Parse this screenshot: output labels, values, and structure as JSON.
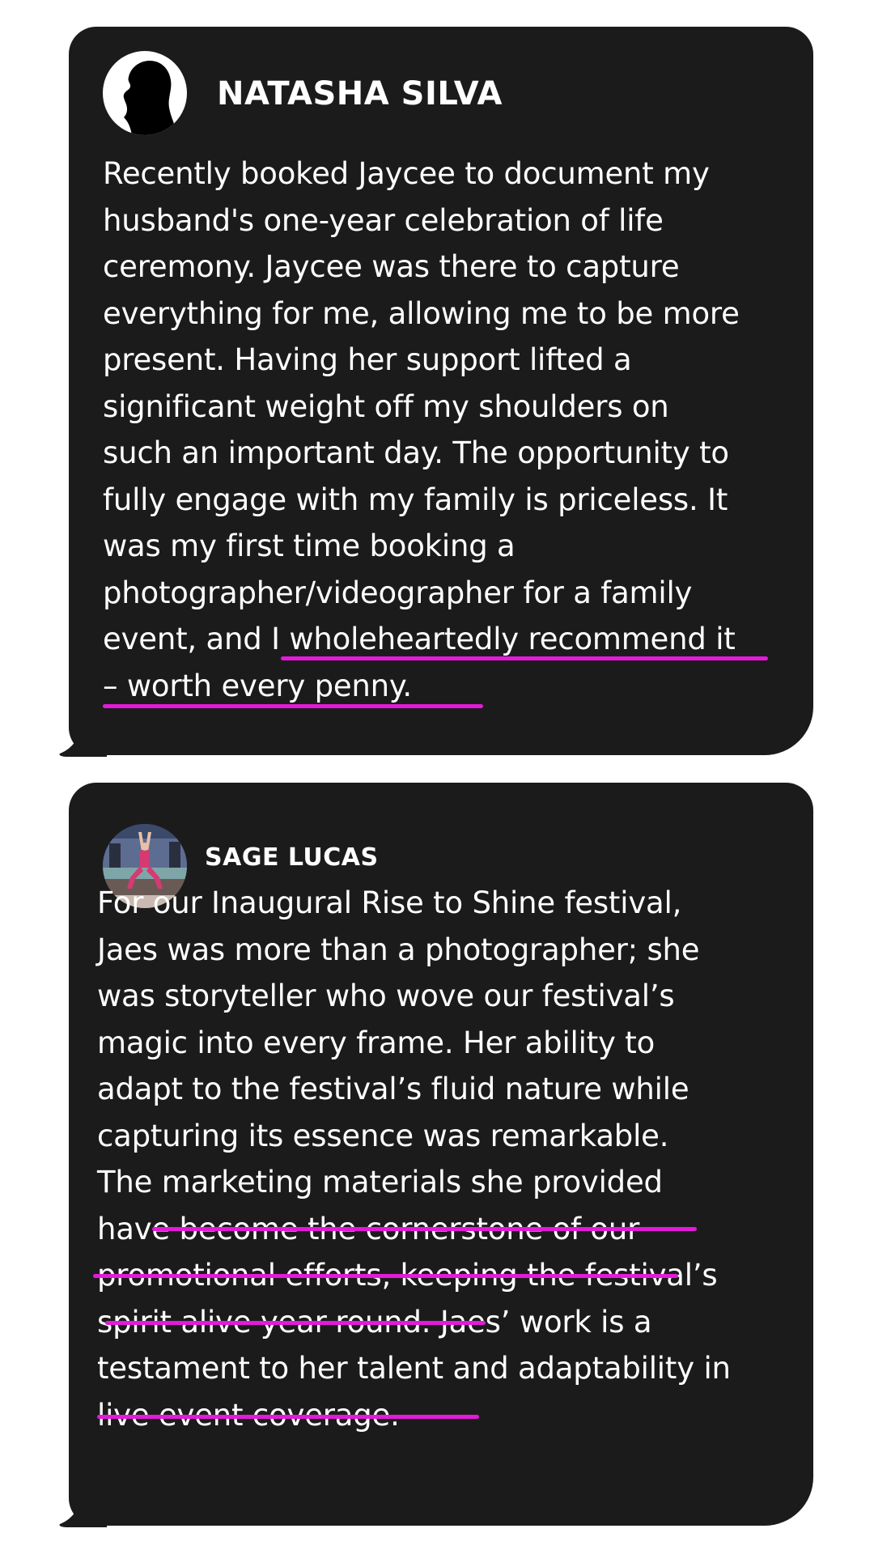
{
  "testimonials": [
    {
      "name": "NATASHA SILVA",
      "avatar": "woman-silhouette-avatar",
      "lines": [
        "Recently booked Jaycee to document my",
        "husband's one-year celebration of life",
        "ceremony. Jaycee was there to capture",
        "everything for me, allowing me to be more",
        "present. Having her support lifted a",
        "significant weight off my shoulders on",
        "such an important day. The opportunity to",
        "fully engage with my family is priceless. It",
        "was my first time booking a",
        "photographer/videographer for a family",
        "event, and I wholeheartedly recommend it",
        "– worth every penny."
      ]
    },
    {
      "name": "SAGE LUCAS",
      "avatar": "festival-performer-photo-avatar",
      "lines": [
        "For our Inaugural Rise to Shine festival,",
        "Jaes was more than a photographer; she",
        "was storyteller who wove our festival’s",
        "magic into every frame. Her ability to",
        "adapt to the festival’s fluid nature while",
        "capturing its essence was remarkable.",
        "The marketing materials she provided",
        "have become the cornerstone of our",
        "promotional efforts, keeping the festival’s",
        "spirit alive year-round. Jaes’ work is a",
        "testament to her talent and adaptability in",
        "live event coverage."
      ]
    }
  ],
  "colors": {
    "bubble": "#1c1b1c",
    "text": "#ffffff",
    "underline": "#e31ad8",
    "background": "#ffffff"
  }
}
